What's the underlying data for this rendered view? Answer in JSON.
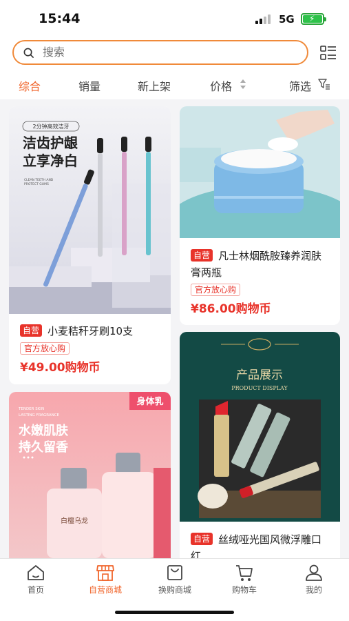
{
  "status": {
    "time": "15:44",
    "network": "5G"
  },
  "search": {
    "placeholder": "搜索"
  },
  "filters": [
    {
      "label": "综合",
      "active": true
    },
    {
      "label": "销量"
    },
    {
      "label": "新上架"
    },
    {
      "label": "价格"
    },
    {
      "label": "筛选"
    }
  ],
  "products": [
    {
      "badge": "自营",
      "title": "小麦秸秆牙刷10支",
      "official": "官方放心购",
      "price": "¥49.00购物币",
      "image_text": {
        "tag": "2分钟高效洁牙",
        "line1": "洁齿护龈",
        "line2": "立享净白",
        "small1": "CLEAN TEETH AND",
        "small2": "PROTECT GUMS"
      }
    },
    {
      "badge": "自营",
      "title": "凡士林烟酰胺臻养润肤膏两瓶",
      "official": "官方放心购",
      "price": "¥86.00购物币"
    },
    {
      "badge": "",
      "title": "",
      "image_text": {
        "corner": "身体乳",
        "small1": "TENDER SKIN",
        "small2": "LASTING FRAGRANCE",
        "line1": "水嫩肌肤",
        "line2": "持久留香",
        "bottle": "白檀乌龙"
      }
    },
    {
      "badge": "自营",
      "title": "丝绒哑光国风微浮雕口红",
      "image_text": {
        "heading": "产品展示",
        "sub": "PRODUCT DISPLAY"
      }
    }
  ],
  "tabbar": [
    {
      "label": "首页",
      "icon": "home-icon"
    },
    {
      "label": "自营商城",
      "icon": "store-icon",
      "active": true
    },
    {
      "label": "换购商城",
      "icon": "bag-icon"
    },
    {
      "label": "购物车",
      "icon": "cart-icon"
    },
    {
      "label": "我的",
      "icon": "user-icon"
    }
  ],
  "colors": {
    "accent": "#f0642a",
    "price": "#e8332a",
    "search_border": "#f08a3a"
  }
}
